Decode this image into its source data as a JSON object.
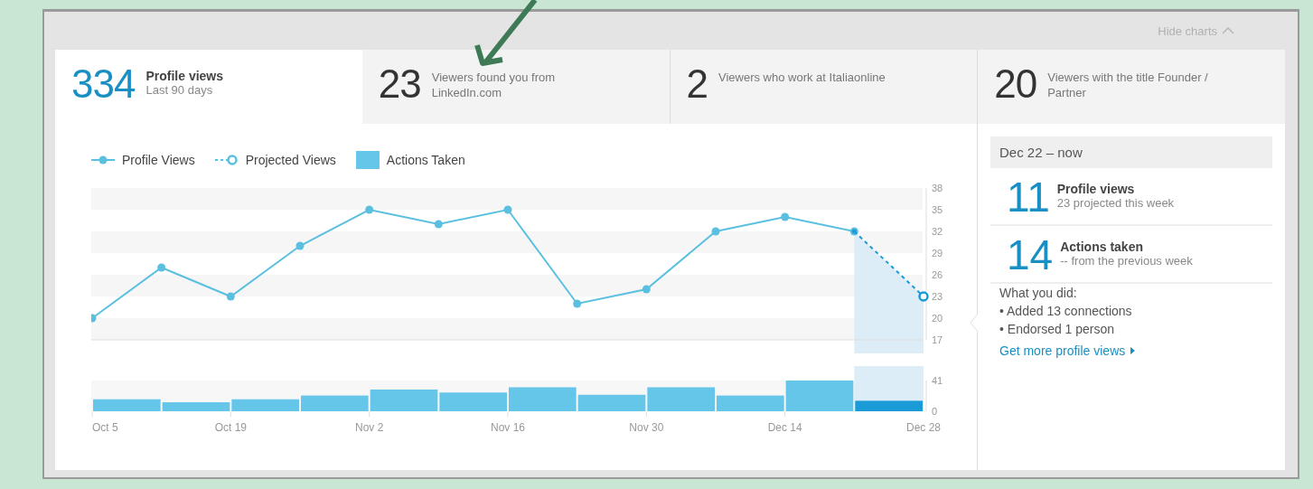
{
  "header": {
    "hide_charts": "Hide charts"
  },
  "tabs": [
    {
      "kind": "summary",
      "number": "334",
      "label": "Profile views",
      "sublabel": "Last 90 days",
      "selected": true
    },
    {
      "kind": "detail",
      "number": "23",
      "label": "Viewers found you from LinkedIn.com",
      "selected": false
    },
    {
      "kind": "detail",
      "number": "2",
      "label": "Viewers who work at Italiaonline",
      "selected": false
    },
    {
      "kind": "detail",
      "number": "20",
      "label": "Viewers with the title Founder / Partner",
      "selected": false
    }
  ],
  "views_chart": {
    "chart_data": {
      "type": "line",
      "ylim": [
        17,
        38
      ],
      "yticks": [
        17,
        20,
        23,
        26,
        29,
        32,
        35,
        38
      ],
      "series": [
        {
          "name": "Profile Views",
          "color": "#5bc0e0",
          "marker": "circle",
          "line_style": "solid",
          "values": [
            20,
            27,
            23,
            30,
            35,
            33,
            35,
            22,
            24,
            32,
            34,
            32,
            null
          ]
        },
        {
          "name": "Projected Views",
          "color": "#1a9ad6",
          "marker": "open-circle",
          "line_style": "dashed",
          "values": [
            null,
            null,
            null,
            null,
            null,
            null,
            null,
            null,
            null,
            null,
            null,
            32,
            23
          ]
        }
      ]
    }
  },
  "actions_chart": {
    "chart_data": {
      "type": "bar",
      "categories": [
        "Oct 5",
        null,
        "Oct 19",
        null,
        "Nov 2",
        null,
        "Nov 16",
        null,
        "Nov 30",
        null,
        "Dec 14",
        null
      ],
      "ylim": [
        0,
        41
      ],
      "yticks": [
        0,
        41
      ],
      "series": [
        {
          "name": "Actions Taken",
          "color": "#66c6ea",
          "colors": [
            "#66c6ea",
            "#66c6ea",
            "#66c6ea",
            "#66c6ea",
            "#66c6ea",
            "#66c6ea",
            "#66c6ea",
            "#66c6ea",
            "#66c6ea",
            "#66c6ea",
            "#66c6ea",
            "#1a9ad6"
          ],
          "values": [
            16,
            12,
            16,
            21,
            29,
            25,
            32,
            22,
            32,
            21,
            41,
            14
          ]
        }
      ]
    },
    "end_label": "Dec 28"
  },
  "sidebar": {
    "period": "Dec 22 – now",
    "stats": [
      {
        "number": "11",
        "label": "Profile views",
        "sublabel": "23 projected this week"
      },
      {
        "number": "14",
        "label": "Actions taken",
        "sublabel": "-- from the previous week"
      }
    ],
    "activity_heading": "What you did:",
    "activity": [
      "• Added 13 connections",
      "• Endorsed 1 person"
    ],
    "link": "Get more profile views"
  }
}
